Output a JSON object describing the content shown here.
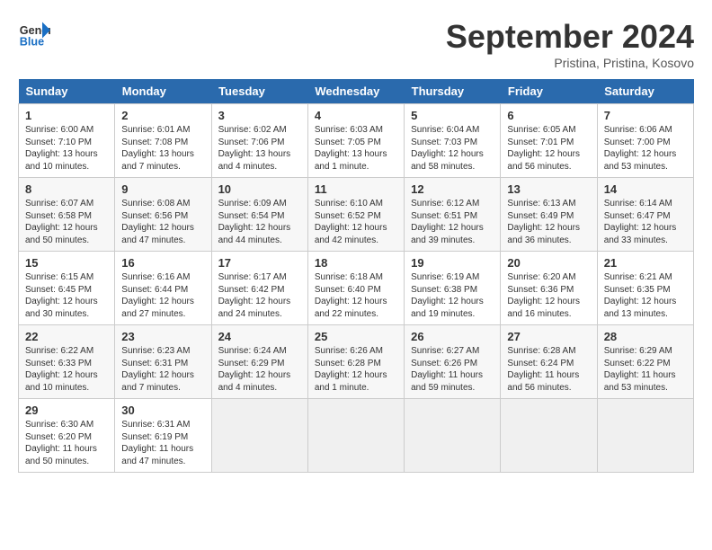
{
  "header": {
    "logo_line1": "General",
    "logo_line2": "Blue",
    "month": "September 2024",
    "location": "Pristina, Pristina, Kosovo"
  },
  "days_of_week": [
    "Sunday",
    "Monday",
    "Tuesday",
    "Wednesday",
    "Thursday",
    "Friday",
    "Saturday"
  ],
  "weeks": [
    [
      {
        "day": 1,
        "sunrise": "6:00 AM",
        "sunset": "7:10 PM",
        "daylight": "13 hours and 10 minutes."
      },
      {
        "day": 2,
        "sunrise": "6:01 AM",
        "sunset": "7:08 PM",
        "daylight": "13 hours and 7 minutes."
      },
      {
        "day": 3,
        "sunrise": "6:02 AM",
        "sunset": "7:06 PM",
        "daylight": "13 hours and 4 minutes."
      },
      {
        "day": 4,
        "sunrise": "6:03 AM",
        "sunset": "7:05 PM",
        "daylight": "13 hours and 1 minute."
      },
      {
        "day": 5,
        "sunrise": "6:04 AM",
        "sunset": "7:03 PM",
        "daylight": "12 hours and 58 minutes."
      },
      {
        "day": 6,
        "sunrise": "6:05 AM",
        "sunset": "7:01 PM",
        "daylight": "12 hours and 56 minutes."
      },
      {
        "day": 7,
        "sunrise": "6:06 AM",
        "sunset": "7:00 PM",
        "daylight": "12 hours and 53 minutes."
      }
    ],
    [
      {
        "day": 8,
        "sunrise": "6:07 AM",
        "sunset": "6:58 PM",
        "daylight": "12 hours and 50 minutes."
      },
      {
        "day": 9,
        "sunrise": "6:08 AM",
        "sunset": "6:56 PM",
        "daylight": "12 hours and 47 minutes."
      },
      {
        "day": 10,
        "sunrise": "6:09 AM",
        "sunset": "6:54 PM",
        "daylight": "12 hours and 44 minutes."
      },
      {
        "day": 11,
        "sunrise": "6:10 AM",
        "sunset": "6:52 PM",
        "daylight": "12 hours and 42 minutes."
      },
      {
        "day": 12,
        "sunrise": "6:12 AM",
        "sunset": "6:51 PM",
        "daylight": "12 hours and 39 minutes."
      },
      {
        "day": 13,
        "sunrise": "6:13 AM",
        "sunset": "6:49 PM",
        "daylight": "12 hours and 36 minutes."
      },
      {
        "day": 14,
        "sunrise": "6:14 AM",
        "sunset": "6:47 PM",
        "daylight": "12 hours and 33 minutes."
      }
    ],
    [
      {
        "day": 15,
        "sunrise": "6:15 AM",
        "sunset": "6:45 PM",
        "daylight": "12 hours and 30 minutes."
      },
      {
        "day": 16,
        "sunrise": "6:16 AM",
        "sunset": "6:44 PM",
        "daylight": "12 hours and 27 minutes."
      },
      {
        "day": 17,
        "sunrise": "6:17 AM",
        "sunset": "6:42 PM",
        "daylight": "12 hours and 24 minutes."
      },
      {
        "day": 18,
        "sunrise": "6:18 AM",
        "sunset": "6:40 PM",
        "daylight": "12 hours and 22 minutes."
      },
      {
        "day": 19,
        "sunrise": "6:19 AM",
        "sunset": "6:38 PM",
        "daylight": "12 hours and 19 minutes."
      },
      {
        "day": 20,
        "sunrise": "6:20 AM",
        "sunset": "6:36 PM",
        "daylight": "12 hours and 16 minutes."
      },
      {
        "day": 21,
        "sunrise": "6:21 AM",
        "sunset": "6:35 PM",
        "daylight": "12 hours and 13 minutes."
      }
    ],
    [
      {
        "day": 22,
        "sunrise": "6:22 AM",
        "sunset": "6:33 PM",
        "daylight": "12 hours and 10 minutes."
      },
      {
        "day": 23,
        "sunrise": "6:23 AM",
        "sunset": "6:31 PM",
        "daylight": "12 hours and 7 minutes."
      },
      {
        "day": 24,
        "sunrise": "6:24 AM",
        "sunset": "6:29 PM",
        "daylight": "12 hours and 4 minutes."
      },
      {
        "day": 25,
        "sunrise": "6:26 AM",
        "sunset": "6:28 PM",
        "daylight": "12 hours and 1 minute."
      },
      {
        "day": 26,
        "sunrise": "6:27 AM",
        "sunset": "6:26 PM",
        "daylight": "11 hours and 59 minutes."
      },
      {
        "day": 27,
        "sunrise": "6:28 AM",
        "sunset": "6:24 PM",
        "daylight": "11 hours and 56 minutes."
      },
      {
        "day": 28,
        "sunrise": "6:29 AM",
        "sunset": "6:22 PM",
        "daylight": "11 hours and 53 minutes."
      }
    ],
    [
      {
        "day": 29,
        "sunrise": "6:30 AM",
        "sunset": "6:20 PM",
        "daylight": "11 hours and 50 minutes."
      },
      {
        "day": 30,
        "sunrise": "6:31 AM",
        "sunset": "6:19 PM",
        "daylight": "11 hours and 47 minutes."
      },
      null,
      null,
      null,
      null,
      null
    ]
  ]
}
